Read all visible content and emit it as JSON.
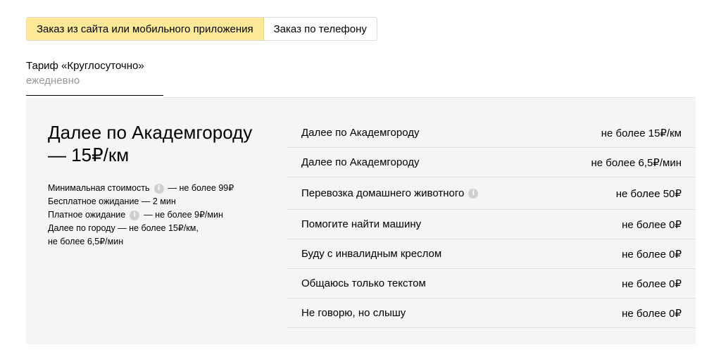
{
  "tabs": [
    {
      "label": "Заказ из сайта или мобильного приложения",
      "active": true
    },
    {
      "label": "Заказ по телефону",
      "active": false
    }
  ],
  "tariff": {
    "title": "Тариф «Круглосуточно»",
    "subtitle": "ежедневно"
  },
  "summary": {
    "headline": "Далее по Академгороду — 15₽/км",
    "min_cost_label": "Минимальная стоимость",
    "min_cost_value": "— не более 99₽",
    "free_wait": "Бесплатное ожидание — 2 мин",
    "paid_wait_label": "Платное ожидание",
    "paid_wait_value": "— не более 9₽/мин",
    "city_line1": "Далее по городу — не более 15₽/км,",
    "city_line2": "не более 6,5₽/мин"
  },
  "rates": [
    {
      "label": "Далее по Академгороду",
      "value": "не более 15₽/км",
      "info": false
    },
    {
      "label": "Далее по Академгороду",
      "value": "не более 6,5₽/мин",
      "info": false
    },
    {
      "label": "Перевозка домашнего животного",
      "value": "не более 50₽",
      "info": true
    },
    {
      "label": "Помогите найти машину",
      "value": "не более 0₽",
      "info": false
    },
    {
      "label": "Буду с инвалидным креслом",
      "value": "не более 0₽",
      "info": false
    },
    {
      "label": "Общаюсь только текстом",
      "value": "не более 0₽",
      "info": false
    },
    {
      "label": "Не говорю, но слышу",
      "value": "не более 0₽",
      "info": false
    }
  ],
  "colors": {
    "active_tab": "#fde997",
    "panel_bg": "#f5f5f5",
    "muted_text": "#999999",
    "info_icon": "#cfcfcf"
  }
}
